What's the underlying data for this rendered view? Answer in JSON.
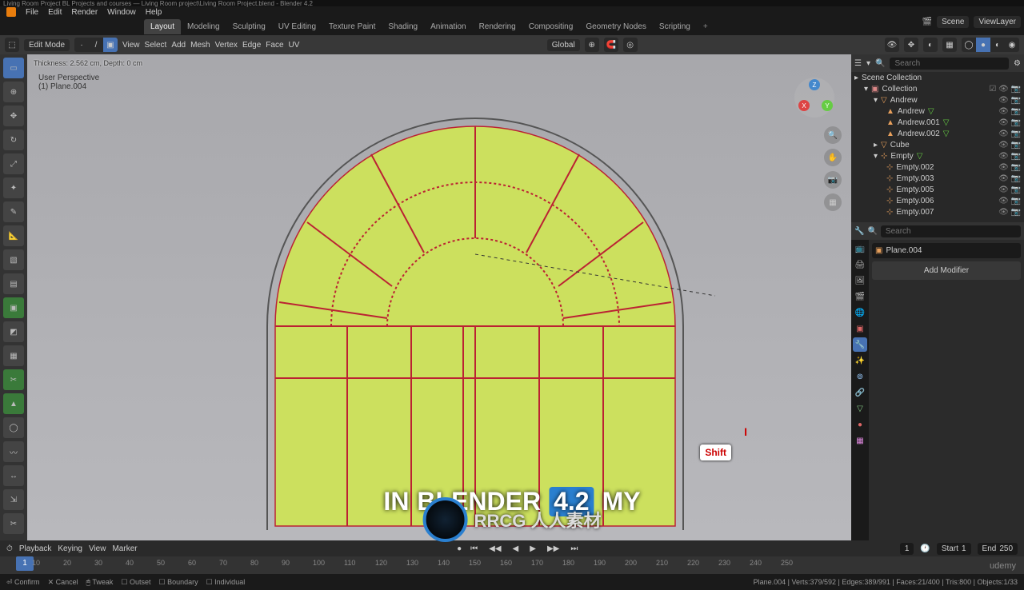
{
  "title": "Living Room Project BL Projects and courses — Living Room project\\Living Room Project.blend - Blender 4.2",
  "menu": [
    "File",
    "Edit",
    "Render",
    "Window",
    "Help"
  ],
  "workspaces": [
    "Layout",
    "Modeling",
    "Sculpting",
    "UV Editing",
    "Texture Paint",
    "Shading",
    "Animation",
    "Rendering",
    "Compositing",
    "Geometry Nodes",
    "Scripting"
  ],
  "active_workspace": "Layout",
  "top_right": {
    "scene": "Scene",
    "viewlayer": "ViewLayer"
  },
  "editor": {
    "mode": "Edit Mode",
    "menus": [
      "View",
      "Select",
      "Add",
      "Mesh",
      "Vertex",
      "Edge",
      "Face",
      "UV"
    ],
    "orientation": "Global"
  },
  "overlay": "Thickness: 2.562 cm, Depth: 0 cm",
  "persp": {
    "line1": "User Perspective",
    "line2": "(1) Plane.004"
  },
  "search_placeholder": "Search",
  "outliner": {
    "root": "Scene Collection",
    "collection": "Collection",
    "items": [
      {
        "name": "Andrew",
        "indent": 2
      },
      {
        "name": "Andrew",
        "indent": 3,
        "leaf": true
      },
      {
        "name": "Andrew.001",
        "indent": 3,
        "leaf": true
      },
      {
        "name": "Andrew.002",
        "indent": 3,
        "leaf": true
      },
      {
        "name": "Cube",
        "indent": 2
      },
      {
        "name": "Empty",
        "indent": 2,
        "empty": true
      },
      {
        "name": "Empty.002",
        "indent": 3,
        "empty": true
      },
      {
        "name": "Empty.003",
        "indent": 3,
        "empty": true
      },
      {
        "name": "Empty.005",
        "indent": 3,
        "empty": true
      },
      {
        "name": "Empty.006",
        "indent": 3,
        "empty": true
      },
      {
        "name": "Empty.007",
        "indent": 3,
        "empty": true
      }
    ]
  },
  "props": {
    "obj": "Plane.004",
    "add": "Add Modifier"
  },
  "timeline": {
    "menus": [
      "Playback",
      "Keying",
      "View",
      "Marker"
    ],
    "ticks": [
      10,
      20,
      30,
      40,
      50,
      60,
      70,
      80,
      90,
      100,
      110,
      120,
      130,
      140,
      150,
      160,
      170,
      180,
      190,
      200,
      210,
      220,
      230,
      240,
      250
    ],
    "current": 1,
    "start_lbl": "Start",
    "start": 1,
    "end_lbl": "End",
    "end": 250
  },
  "statusbar": {
    "items": [
      "Confirm",
      "Cancel",
      "Tweak",
      "Outset",
      "Boundary",
      "Individual"
    ],
    "info": "Plane.004 | Verts:379/592 | Edges:389/991 | Faces:21/400 | Tris:800 | Objects:1/33"
  },
  "subtitle": {
    "w1": "IN",
    "w2": "BLENDER",
    "w3": "4.2",
    "w4": "MY"
  },
  "watermark": "RRCG 人人素材",
  "key": "Shift",
  "udemy": "udemy"
}
